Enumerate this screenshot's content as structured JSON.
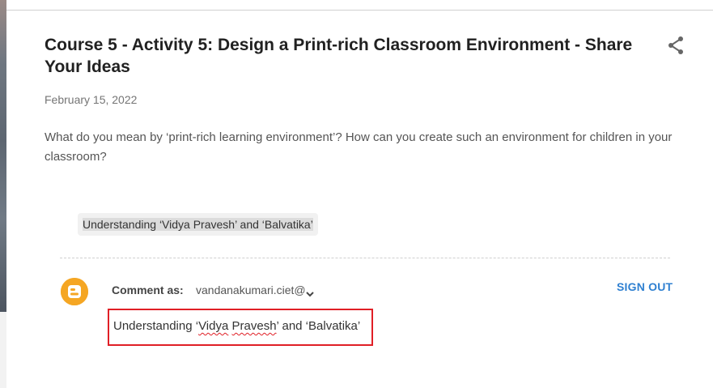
{
  "post": {
    "title": "Course 5 - Activity 5: Design a Print-rich Classroom Environment - Share Your Ideas",
    "date": "February 15, 2022",
    "body": "What do you mean by ‘print-rich learning environment’? How can you create such an environment for children in your classroom?"
  },
  "label_chip": {
    "text": "Understanding ‘Vidya Pravesh’ and ‘Balvatika’"
  },
  "comment_section": {
    "comment_as_label": "Comment as:",
    "account": "vandanakumari.ciet@",
    "sign_out_label": "SIGN OUT",
    "comment_text": {
      "part1": "Understanding ‘",
      "word1": "Vidya",
      "space": " ",
      "word2": "Pravesh",
      "part2": "’ and ‘",
      "word3": "Balvatika",
      "part3": "’"
    }
  },
  "icons": {
    "share": "share-icon",
    "avatar": "blogger-icon",
    "chevron": "chevron-down-icon"
  },
  "colors": {
    "highlight_border": "#e01f26",
    "blogger_orange": "#f5a623",
    "link_blue": "#2f80d1"
  }
}
